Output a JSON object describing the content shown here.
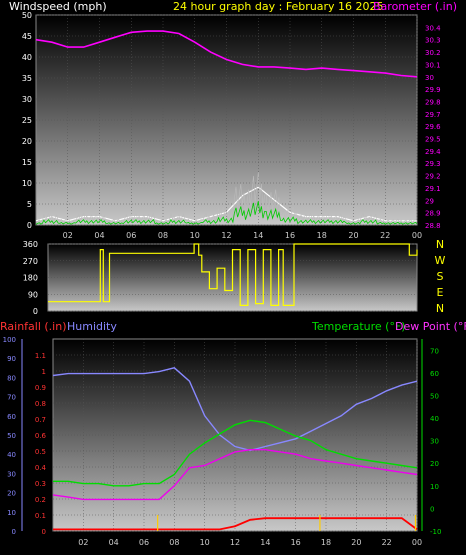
{
  "header": {
    "windspeed_label": "Windspeed (mph)",
    "title": "24 hour graph day : February 16 2025",
    "barometer_label": "Barometer (.in)"
  },
  "lower_header": {
    "rainfall_label": "Rainfall (.in)",
    "humidity_label": "Humidity",
    "temperature_label": "Temperature (°F)",
    "dewpoint_label": "Dew Point (°F)"
  },
  "hour_ticks": [
    "02",
    "04",
    "06",
    "08",
    "10",
    "12",
    "14",
    "16",
    "18",
    "20",
    "22",
    "00"
  ],
  "colors": {
    "windspeed": "#ffffff",
    "wind_avg": "#00cc00",
    "barometer": "#ff00ff",
    "direction": "#ffff00",
    "rainfall": "#ff0000",
    "humidity": "#8888ff",
    "temperature": "#00dd00",
    "dewpoint": "#ee00ee",
    "rain_rate_marks": "#ffcc00"
  },
  "chart_data": [
    {
      "type": "line",
      "name": "wind-barometer",
      "x": [
        0,
        1,
        2,
        3,
        4,
        5,
        6,
        7,
        8,
        9,
        10,
        11,
        12,
        13,
        14,
        15,
        16,
        17,
        18,
        19,
        20,
        21,
        22,
        23,
        24
      ],
      "series": [
        {
          "name": "Windspeed (mph)",
          "axis": "left",
          "values": [
            1,
            2,
            1,
            2,
            2,
            1,
            2,
            2,
            1,
            2,
            1,
            2,
            3,
            7,
            9,
            6,
            3,
            2,
            2,
            2,
            1,
            2,
            1,
            1,
            1
          ]
        },
        {
          "name": "Barometer (.in)",
          "axis": "right",
          "values": [
            30.3,
            30.28,
            30.24,
            30.24,
            30.28,
            30.32,
            30.36,
            30.37,
            30.37,
            30.35,
            30.28,
            30.2,
            30.14,
            30.1,
            30.08,
            30.08,
            30.07,
            30.06,
            30.07,
            30.06,
            30.05,
            30.04,
            30.03,
            30.01,
            30.0
          ]
        }
      ],
      "ylim_left": [
        0,
        50
      ],
      "yticks_left": [
        "0",
        "5",
        "10",
        "15",
        "20",
        "25",
        "30",
        "35",
        "40",
        "45",
        "50"
      ],
      "ylim_right": [
        28.8,
        30.5
      ],
      "yticks_right": [
        "28.8",
        "28.9",
        "29",
        "29.1",
        "29.2",
        "29.3",
        "29.4",
        "29.5",
        "29.6",
        "29.7",
        "29.8",
        "29.9",
        "30",
        "30.1",
        "30.2",
        "30.3",
        "30.4"
      ]
    },
    {
      "type": "line",
      "name": "wind-direction",
      "x": [
        0,
        0.8,
        1.5,
        3.2,
        3.4,
        3.6,
        4.0,
        8.0,
        9.5,
        9.8,
        10.0,
        10.5,
        11.0,
        11.5,
        12.0,
        12.5,
        13.0,
        13.5,
        14.0,
        14.5,
        15.0,
        15.3,
        16.0,
        23.0,
        23.5,
        24.0
      ],
      "series": [
        {
          "name": "Direction",
          "values": [
            50,
            50,
            50,
            50,
            330,
            50,
            310,
            310,
            360,
            300,
            210,
            120,
            230,
            110,
            330,
            30,
            330,
            40,
            330,
            30,
            330,
            30,
            360,
            360,
            300,
            330
          ]
        }
      ],
      "ylim": [
        0,
        360
      ],
      "yticks": [
        "0",
        "90",
        "180",
        "270",
        "360"
      ],
      "compass": [
        "N",
        "W",
        "S",
        "E",
        "N"
      ]
    },
    {
      "type": "line",
      "name": "temp-humidity-rain",
      "x": [
        0,
        1,
        2,
        3,
        4,
        5,
        6,
        7,
        8,
        9,
        10,
        11,
        12,
        13,
        14,
        15,
        16,
        17,
        18,
        19,
        20,
        21,
        22,
        23,
        24
      ],
      "series": [
        {
          "name": "Humidity",
          "axis": "far-left",
          "values": [
            81,
            82,
            82,
            82,
            82,
            82,
            82,
            83,
            85,
            78,
            60,
            50,
            44,
            42,
            44,
            46,
            48,
            52,
            56,
            60,
            66,
            69,
            73,
            76,
            78
          ]
        },
        {
          "name": "Temperature (°F)",
          "axis": "right",
          "values": [
            12,
            12,
            11,
            11,
            10,
            10,
            11,
            11,
            15,
            24,
            29,
            33,
            37,
            39,
            38,
            35,
            32,
            30,
            26,
            24,
            22,
            21,
            20,
            19,
            18
          ]
        },
        {
          "name": "Dew Point (°F)",
          "axis": "right",
          "values": [
            6,
            5,
            4,
            4,
            4,
            4,
            4,
            4,
            10,
            18,
            19,
            22,
            25,
            26,
            26,
            25,
            24,
            22,
            21,
            20,
            19,
            18,
            17,
            16,
            15
          ]
        },
        {
          "name": "Rainfall (.in)",
          "axis": "left",
          "values": [
            0.01,
            0.01,
            0.01,
            0.01,
            0.01,
            0.01,
            0.01,
            0.01,
            0.01,
            0.01,
            0.01,
            0.01,
            0.03,
            0.07,
            0.08,
            0.08,
            0.08,
            0.08,
            0.08,
            0.08,
            0.08,
            0.08,
            0.08,
            0.08,
            0.01
          ]
        }
      ],
      "rain_rate_marks_x": [
        6.9,
        17.6,
        23.9
      ],
      "ylim_far_left": [
        0,
        100
      ],
      "yticks_far_left": [
        "0",
        "10",
        "20",
        "30",
        "40",
        "50",
        "60",
        "70",
        "80",
        "90",
        "100"
      ],
      "ylim_left": [
        0,
        1.2
      ],
      "yticks_left": [
        "0",
        "0.1",
        "0.2",
        "0.3",
        "0.4",
        "0.5",
        "0.6",
        "0.7",
        "0.8",
        "0.9",
        "1",
        "1.1"
      ],
      "ylim_right": [
        -10,
        75
      ],
      "yticks_right": [
        "-10",
        "0",
        "10",
        "20",
        "30",
        "40",
        "50",
        "60",
        "70"
      ]
    }
  ]
}
